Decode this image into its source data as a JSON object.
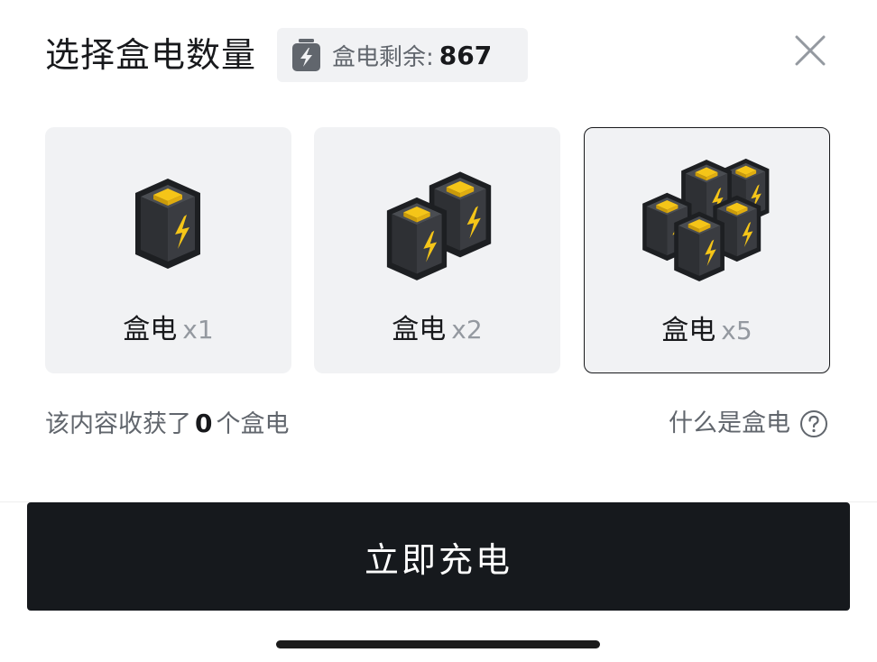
{
  "header": {
    "title": "选择盒电数量",
    "balance_label": "盒电剩余:",
    "balance_value": "867",
    "balance_icon": "battery-bolt-icon",
    "close_icon": "close-icon"
  },
  "options": [
    {
      "name": "盒电",
      "qty": "x1",
      "selected": false
    },
    {
      "name": "盒电",
      "qty": "x2",
      "selected": false
    },
    {
      "name": "盒电",
      "qty": "x5",
      "selected": true
    }
  ],
  "info": {
    "received_prefix": "该内容收获了",
    "received_count": "0",
    "received_suffix": "个盒电",
    "what_is_link": "什么是盒电",
    "help_icon": "question-circle-icon"
  },
  "action": {
    "charge_label": "立即充电"
  },
  "colors": {
    "battery_body": "#2b2d31",
    "battery_top": "#f5c518",
    "bolt": "#f5c518",
    "button_bg": "#16191d",
    "card_bg": "#f1f2f4"
  }
}
